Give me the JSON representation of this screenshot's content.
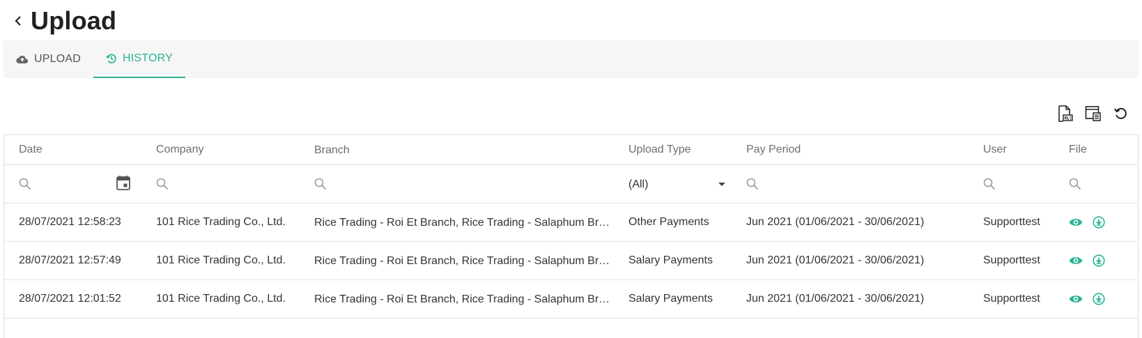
{
  "page": {
    "title": "Upload"
  },
  "tabs": [
    {
      "label": "UPLOAD",
      "icon": "cloud-upload-icon",
      "active": false
    },
    {
      "label": "HISTORY",
      "icon": "history-icon",
      "active": true
    }
  ],
  "toolbar": {
    "icons": [
      "export-excel-icon",
      "column-chooser-icon",
      "refresh-icon"
    ]
  },
  "table": {
    "columns": [
      "Date",
      "Company",
      "Branch",
      "Upload Type",
      "Pay Period",
      "User",
      "File"
    ],
    "filters": {
      "upload_type": "(All)"
    },
    "rows": [
      {
        "date": "28/07/2021 12:58:23",
        "company": "101 Rice Trading Co., Ltd.",
        "branch": "Rice Trading - Roi Et Branch, Rice Trading - Salaphum Branch",
        "upload_type": "Other Payments",
        "pay_period": "Jun 2021 (01/06/2021 - 30/06/2021)",
        "user": "Supporttest"
      },
      {
        "date": "28/07/2021 12:57:49",
        "company": "101 Rice Trading Co., Ltd.",
        "branch": "Rice Trading - Roi Et Branch, Rice Trading - Salaphum Branch",
        "upload_type": "Salary Payments",
        "pay_period": "Jun 2021 (01/06/2021 - 30/06/2021)",
        "user": "Supporttest"
      },
      {
        "date": "28/07/2021 12:01:52",
        "company": "101 Rice Trading Co., Ltd.",
        "branch": "Rice Trading - Roi Et Branch, Rice Trading - Salaphum Branch",
        "upload_type": "Salary Payments",
        "pay_period": "Jun 2021 (01/06/2021 - 30/06/2021)",
        "user": "Supporttest"
      }
    ]
  },
  "colors": {
    "accent": "#2ab397",
    "tab_bar_bg": "#f6f6f6",
    "border": "#dddddd"
  }
}
